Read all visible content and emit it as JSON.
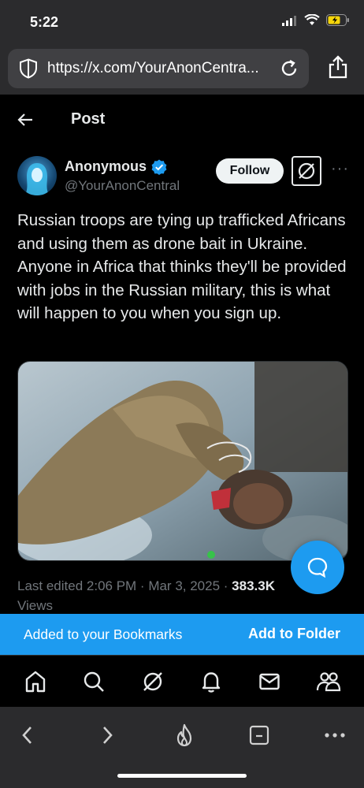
{
  "status_bar": {
    "time": "5:22"
  },
  "browser": {
    "url": "https://x.com/YourAnonCentra..."
  },
  "header": {
    "title": "Post"
  },
  "author": {
    "name": "Anonymous",
    "handle": "@YourAnonCentral",
    "verified": true
  },
  "actions": {
    "follow_label": "Follow",
    "more_label": "···"
  },
  "tweet": {
    "text": "Russian troops are tying up trafficked Africans and using them as drone bait in Ukraine. Anyone in Africa that thinks they'll be provided with jobs in the Russian military, this is what will happen to you when you sign up.",
    "meta_prefix": "Last edited 2:06 PM · Mar 3, 2025 · ",
    "view_count": "383.3K",
    "views_label": "Views"
  },
  "toast": {
    "message": "Added to your Bookmarks",
    "action": "Add to Folder"
  },
  "bottom_nav": {
    "items": [
      "home-icon",
      "search-icon",
      "grok-icon",
      "notifications-icon",
      "messages-icon",
      "communities-icon"
    ]
  },
  "browser_toolbar": {
    "items": [
      "back-icon",
      "forward-icon",
      "flame-icon",
      "tabs-icon",
      "more-icon"
    ]
  },
  "colors": {
    "accent": "#1d9bf0",
    "background": "#000000",
    "text": "#e7e9ea",
    "secondary": "#71767b",
    "browser_chrome": "#2b2b2d"
  }
}
